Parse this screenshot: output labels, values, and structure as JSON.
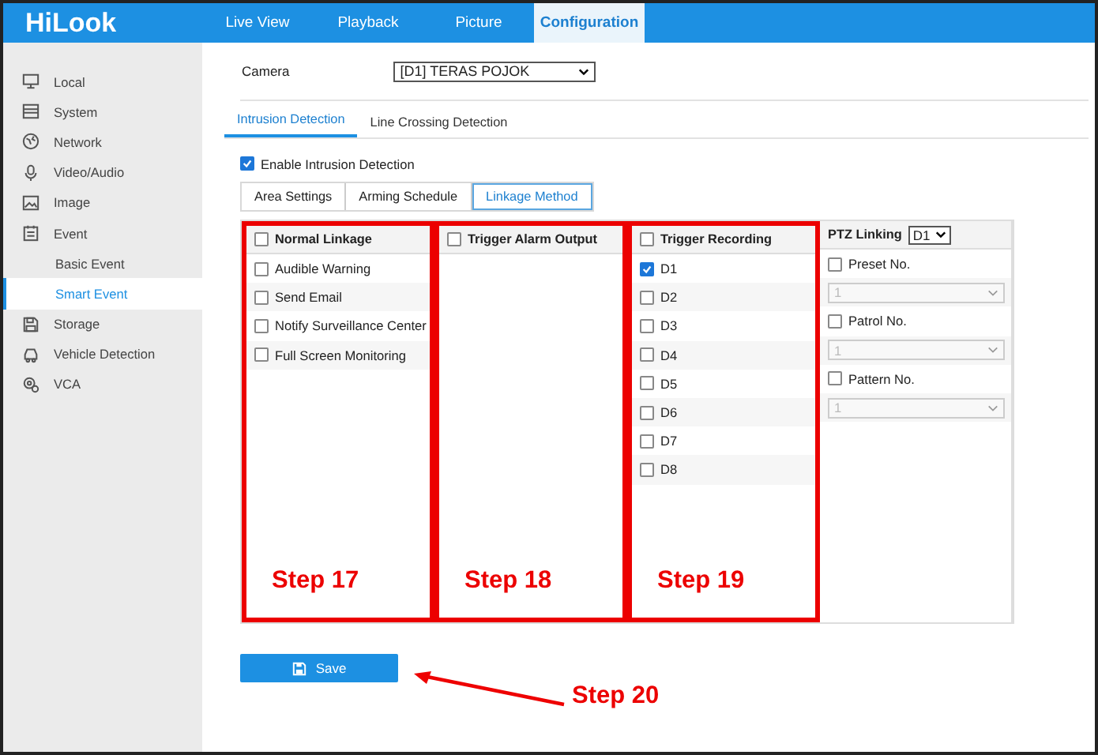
{
  "logo": "HiLook",
  "nav_tabs": [
    {
      "label": "Live View",
      "selected": false
    },
    {
      "label": "Playback",
      "selected": false
    },
    {
      "label": "Picture",
      "selected": false
    },
    {
      "label": "Configuration",
      "selected": true
    }
  ],
  "sidebar": {
    "items": [
      {
        "label": "Local",
        "selected": false
      },
      {
        "label": "System",
        "selected": false
      },
      {
        "label": "Network",
        "selected": false
      },
      {
        "label": "Video/Audio",
        "selected": false
      },
      {
        "label": "Image",
        "selected": false
      },
      {
        "label": "Event",
        "selected": false,
        "children": [
          {
            "label": "Basic Event",
            "selected": false
          },
          {
            "label": "Smart Event",
            "selected": true
          }
        ]
      },
      {
        "label": "Storage",
        "selected": false
      },
      {
        "label": "Vehicle Detection",
        "selected": false
      },
      {
        "label": "VCA",
        "selected": false
      }
    ]
  },
  "camera": {
    "label": "Camera",
    "value": "[D1] TERAS POJOK"
  },
  "sub_tabs": [
    {
      "label": "Intrusion Detection",
      "selected": true
    },
    {
      "label": "Line Crossing Detection",
      "selected": false
    }
  ],
  "enable": {
    "label": "Enable Intrusion Detection",
    "checked": true
  },
  "steps": [
    {
      "label": "Area Settings",
      "selected": false
    },
    {
      "label": "Arming Schedule",
      "selected": false
    },
    {
      "label": "Linkage Method",
      "selected": true
    }
  ],
  "linkage_columns": [
    {
      "label": "Normal Linkage",
      "checked": false,
      "annotation": "Step 17",
      "items": [
        {
          "label": "Audible Warning",
          "checked": false
        },
        {
          "label": "Send Email",
          "checked": false
        },
        {
          "label": "Notify Surveillance Center",
          "checked": false
        },
        {
          "label": "Full Screen Monitoring",
          "checked": false
        }
      ]
    },
    {
      "label": "Trigger Alarm Output",
      "checked": false,
      "annotation": "Step 18"
    },
    {
      "label": "Trigger Recording",
      "checked": false,
      "annotation": "Step 19",
      "items": [
        {
          "label": "D1",
          "checked": true
        },
        {
          "label": "D2",
          "checked": false
        },
        {
          "label": "D3",
          "checked": false
        },
        {
          "label": "D4",
          "checked": false
        },
        {
          "label": "D5",
          "checked": false
        },
        {
          "label": "D6",
          "checked": false
        },
        {
          "label": "D7",
          "checked": false
        },
        {
          "label": "D8",
          "checked": false
        }
      ]
    }
  ],
  "ptz": {
    "label": "PTZ Linking",
    "channel": "D1",
    "items": [
      {
        "kind": "checkbox",
        "label": "Preset No.",
        "checked": false
      },
      {
        "kind": "select",
        "value": "1",
        "disabled": true
      },
      {
        "kind": "checkbox",
        "label": "Patrol No.",
        "checked": false
      },
      {
        "kind": "select",
        "value": "1",
        "disabled": true
      },
      {
        "kind": "checkbox",
        "label": "Pattern No.",
        "checked": false
      },
      {
        "kind": "select",
        "value": "1",
        "disabled": true
      }
    ]
  },
  "save_button": {
    "label": "Save"
  },
  "callout": {
    "label": "Step 20"
  }
}
